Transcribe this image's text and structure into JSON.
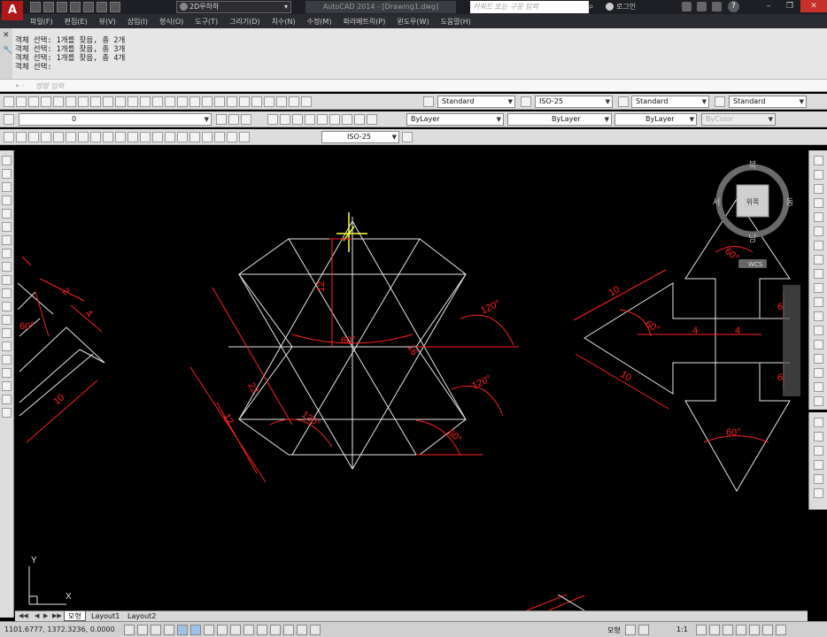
{
  "titlebar": {
    "logo": "A",
    "workspace": "2D우하하",
    "app_title": "AutoCAD 2014 - [Drawing1.dwg]",
    "search_placeholder": "키워드 또는 구문 입력",
    "login": "로그인",
    "help": "?"
  },
  "menubar": {
    "items": [
      "파일(F)",
      "편집(E)",
      "뷰(V)",
      "삽입(I)",
      "형식(O)",
      "도구(T)",
      "그리기(D)",
      "치수(N)",
      "수정(M)",
      "파라메트릭(P)",
      "윈도우(W)",
      "도움말(H)"
    ]
  },
  "command": {
    "history": [
      "객체 선택: 1개를 찾음, 총 2개",
      "객체 선택: 1개를 찾음, 총 3개",
      "객체 선택: 1개를 찾음, 총 4개",
      "객체 선택:"
    ],
    "prompt": "▸ -",
    "placeholder": "명령 입력"
  },
  "toolbar1": {
    "text_style": "Standard",
    "dim_style": "ISO-25",
    "table_style": "Standard",
    "mleader_style": "Standard"
  },
  "toolbar2": {
    "layer": "0",
    "color": "ByLayer",
    "linetype": "ByLayer",
    "lineweight": "ByLayer",
    "plotstyle": "ByColor"
  },
  "toolbar3": {
    "dim_style": "ISO-25"
  },
  "viewcube": {
    "north": "북",
    "south": "남",
    "east": "동",
    "west": "서",
    "face": "위쪽",
    "ucs": "WCS"
  },
  "ucs_icon": {
    "x": "X",
    "y": "Y"
  },
  "dims": {
    "d10_left": "10",
    "d4_left": "4",
    "d2_left": "2",
    "d60_left": "60°",
    "d12_center_top": "12",
    "d60_center": "60°",
    "d16_center": "16",
    "d120_top": "120°",
    "d22": "22",
    "d12_lower": "12",
    "d120_lower_right": "120°",
    "d120_lower_left": "120°",
    "d60_lower": "60°",
    "d10_right_top": "10",
    "d10_right_bottom": "10",
    "d60_right": "60°",
    "d4_right_a": "4",
    "d4_right_b": "4",
    "d60_right_top": "60°",
    "d60_right_bottom": "60°",
    "d6_right": "6",
    "d6_right2": "6"
  },
  "tabs": {
    "model": "모형",
    "layout1": "Layout1",
    "layout2": "Layout2"
  },
  "status": {
    "coords": "1101.6777, 1372.3236, 0.0000",
    "model": "모형",
    "scale": "1:1"
  },
  "colors": {
    "geometry": "#e6e6e6",
    "dimension": "#ff2020",
    "crosshair": "#ffff40"
  }
}
